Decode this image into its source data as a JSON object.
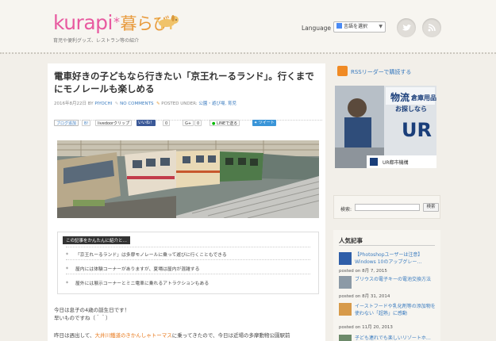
{
  "header": {
    "logo_text": "kurapi",
    "logo_star": "*",
    "logo_kana": "暮らび",
    "tagline": "育児や便利グッズ、レストラン等の紹介",
    "language_label": "Language :",
    "language_select": "言語を選択",
    "icons": [
      "twitter-bird-icon",
      "rss-feed-icon"
    ]
  },
  "post": {
    "title": "電車好きの子どもなら行きたい「京王れーるランド」。行くまでにモノレールも楽しめる",
    "date": "2016年8月22日",
    "by": "BY",
    "author": "PIYOCHI",
    "comments": "NO COMMENTS",
    "posted_under": "POSTED UNDER:",
    "categories": "公園・遊び場, 育児",
    "share": {
      "hatena": "ブログ追加",
      "hatena_count": "B!",
      "livedoor": "livedoorクリップ",
      "like": "いいね！",
      "like_count": "0",
      "gplus": "G+",
      "gplus_count": "0",
      "line": "LINEで送る",
      "tweet": "ツイート"
    },
    "summary": {
      "heading": "この記事をかんたんに紹介と…",
      "items": [
        "「京王れーるランド」は多摩モノレールに乗って遊びに行くこともできる",
        "屋内には体験コーナーがありますが、夏場は屋内が混雑する",
        "屋外には展示コーナーとミニ電車に乗れるアトラクションもある"
      ]
    },
    "body": {
      "p1_line1": "今日は息子の4歳の誕生日です！",
      "p1_line2": "早いものですね（＾＾）",
      "p2_prefix": "昨日は週出して、",
      "p2_highlight": "大井川鐵道のきかんしゃトーマス",
      "p2_suffix": "に乗ってきたので、今日は近場の多摩動物公園駅前"
    }
  },
  "sidebar": {
    "rss_text": "RSSリーダーで購読する",
    "ad": {
      "headline_1": "物流",
      "headline_2": "倉庫用品",
      "headline_3": "お探しなら",
      "brand": "UR",
      "company": "UR都市機構"
    },
    "search": {
      "label": "検索:",
      "button": "検索"
    },
    "popular": {
      "title": "人気記事",
      "posts": [
        {
          "title": "【Photoshopユーザーは注意】Windows 10のアップグレー…",
          "date": "posted on 8月 7, 2015"
        },
        {
          "title": "ブリウスの電子キーの電池交換方法",
          "date": "posted on 8月 31, 2014"
        },
        {
          "title": "イーストフードや乳化剤等の添加物を使わない「超熟」に感動",
          "date": "posted on 11月 20, 2013"
        },
        {
          "title": "子ども連れでも楽しいリゾートホ…",
          "date": ""
        }
      ]
    }
  },
  "colors": {
    "accent_pink": "#e85aa0",
    "accent_orange": "#e89a3c",
    "link_blue": "#3a7bbf",
    "highlight_orange": "#e8781a"
  }
}
